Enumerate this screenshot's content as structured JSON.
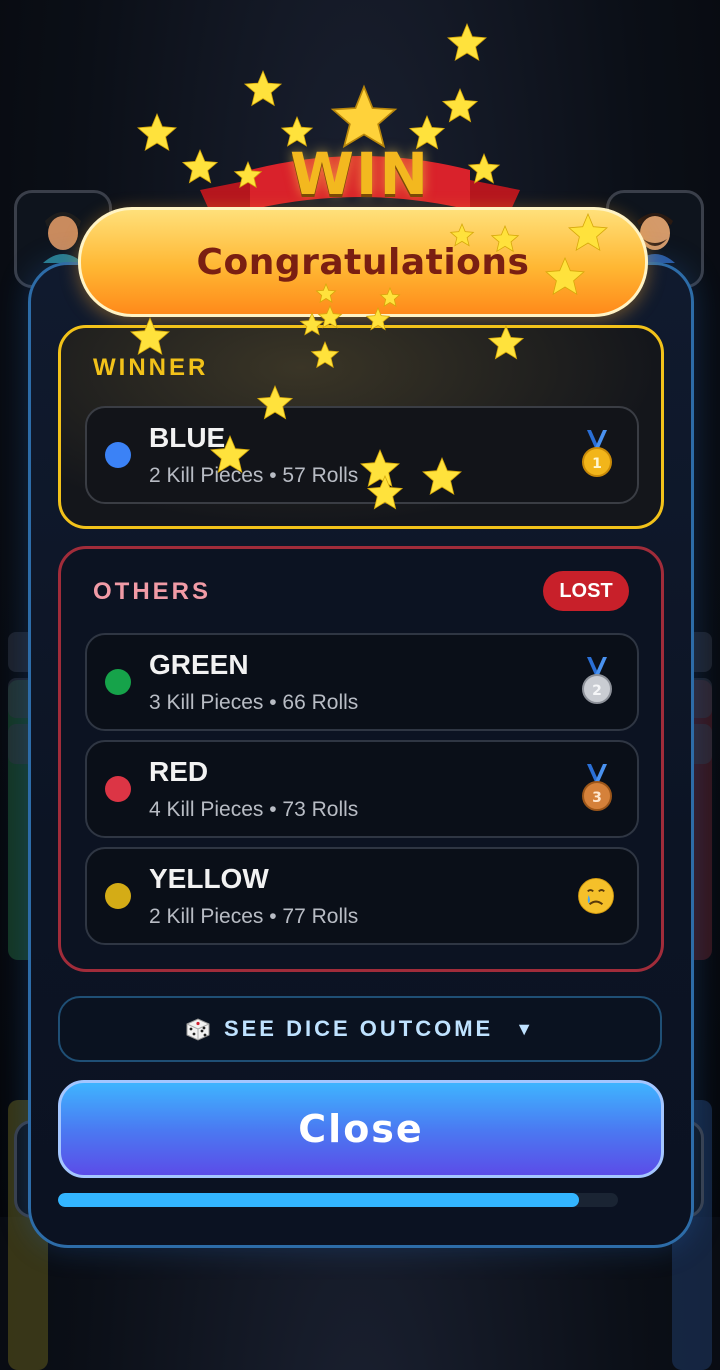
{
  "banner": {
    "emblem_text": "WIN",
    "title": "Congratulations"
  },
  "winner_section": {
    "title": "WINNER",
    "player": {
      "name": "BLUE",
      "stats": "2 Kill Pieces • 57 Rolls",
      "color": "#3b82f6",
      "medal": "gold-medal-1"
    }
  },
  "others_section": {
    "title": "OTHERS",
    "badge": "LOST",
    "players": [
      {
        "name": "GREEN",
        "stats": "3 Kill Pieces • 66 Rolls",
        "color": "#16a34a",
        "medal": "silver-medal-2"
      },
      {
        "name": "RED",
        "stats": "4 Kill Pieces • 73 Rolls",
        "color": "#dc3545",
        "medal": "bronze-medal-3"
      },
      {
        "name": "YELLOW",
        "stats": "2 Kill Pieces • 77 Rolls",
        "color": "#d4ac16",
        "medal": "crying-face"
      }
    ]
  },
  "dice_outcome": {
    "label": "SEE DICE OUTCOME",
    "arrow": "▼",
    "icon": "dice-icon"
  },
  "close_button": {
    "label": "Close"
  },
  "progress": {
    "fraction": 0.93
  },
  "colors": {
    "gold": "#f2c21a",
    "lost_red": "#c8202a",
    "modal_border": "#2d6ca8"
  }
}
